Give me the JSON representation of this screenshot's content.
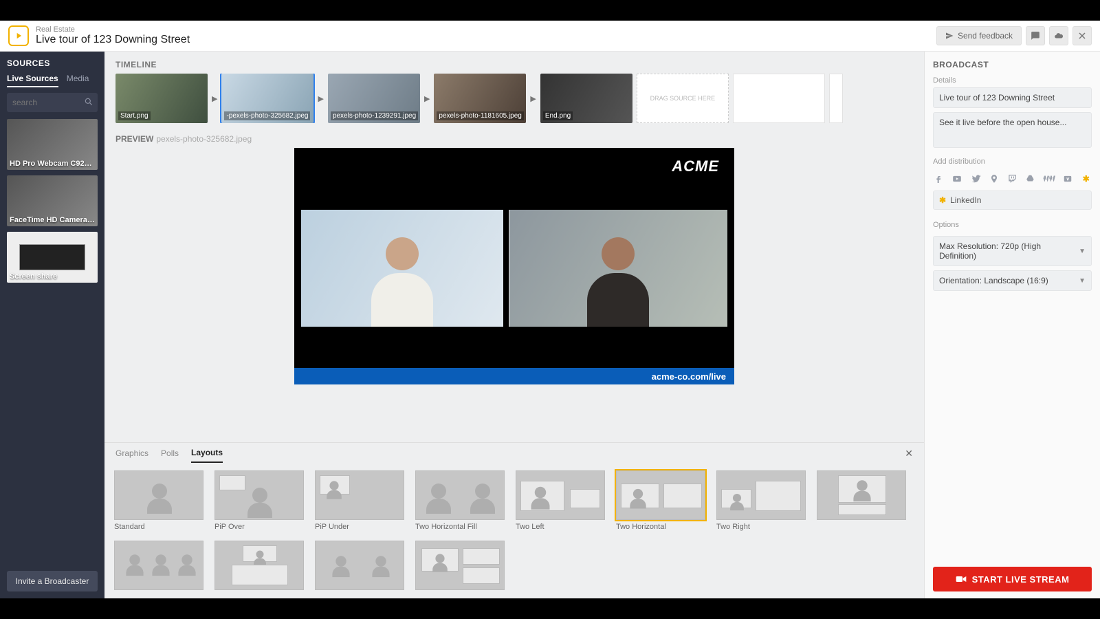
{
  "header": {
    "subtitle": "Real Estate",
    "title": "Live tour of 123 Downing Street",
    "feedback": "Send feedback"
  },
  "sources": {
    "title": "SOURCES",
    "tabs": {
      "live": "Live Sources",
      "media": "Media"
    },
    "search_placeholder": "search",
    "items": [
      {
        "label": "HD Pro Webcam C920…"
      },
      {
        "label": "FaceTime HD Camera …"
      },
      {
        "label": "Screen share"
      }
    ],
    "invite": "Invite a Broadcaster"
  },
  "timeline": {
    "title": "TIMELINE",
    "items": [
      {
        "caption": "Start.png"
      },
      {
        "caption": "-pexels-photo-325682.jpeg"
      },
      {
        "caption": "pexels-photo-1239291.jpeg"
      },
      {
        "caption": "pexels-photo-1181605.jpeg"
      },
      {
        "caption": "End.png"
      }
    ],
    "placeholder": "DRAG SOURCE HERE"
  },
  "preview": {
    "title": "PREVIEW",
    "filename": "pexels-photo-325682.jpeg",
    "brand": "ACME",
    "lower_text": "acme-co.com/live"
  },
  "layouts": {
    "tabs": {
      "graphics": "Graphics",
      "polls": "Polls",
      "layouts": "Layouts"
    },
    "items": [
      "Standard",
      "PiP Over",
      "PiP Under",
      "Two Horizontal Fill",
      "Two Left",
      "Two Horizontal",
      "Two Right",
      "",
      "",
      "",
      "",
      ""
    ]
  },
  "broadcast": {
    "title": "BROADCAST",
    "details_label": "Details",
    "name": "Live tour of 123 Downing Street",
    "description": "See it live before the open house...",
    "dist_label": "Add distribution",
    "dist_chip": "LinkedIn",
    "options_label": "Options",
    "resolution": "Max Resolution: 720p (High Definition)",
    "orientation": "Orientation: Landscape (16:9)",
    "start": "START LIVE STREAM"
  }
}
